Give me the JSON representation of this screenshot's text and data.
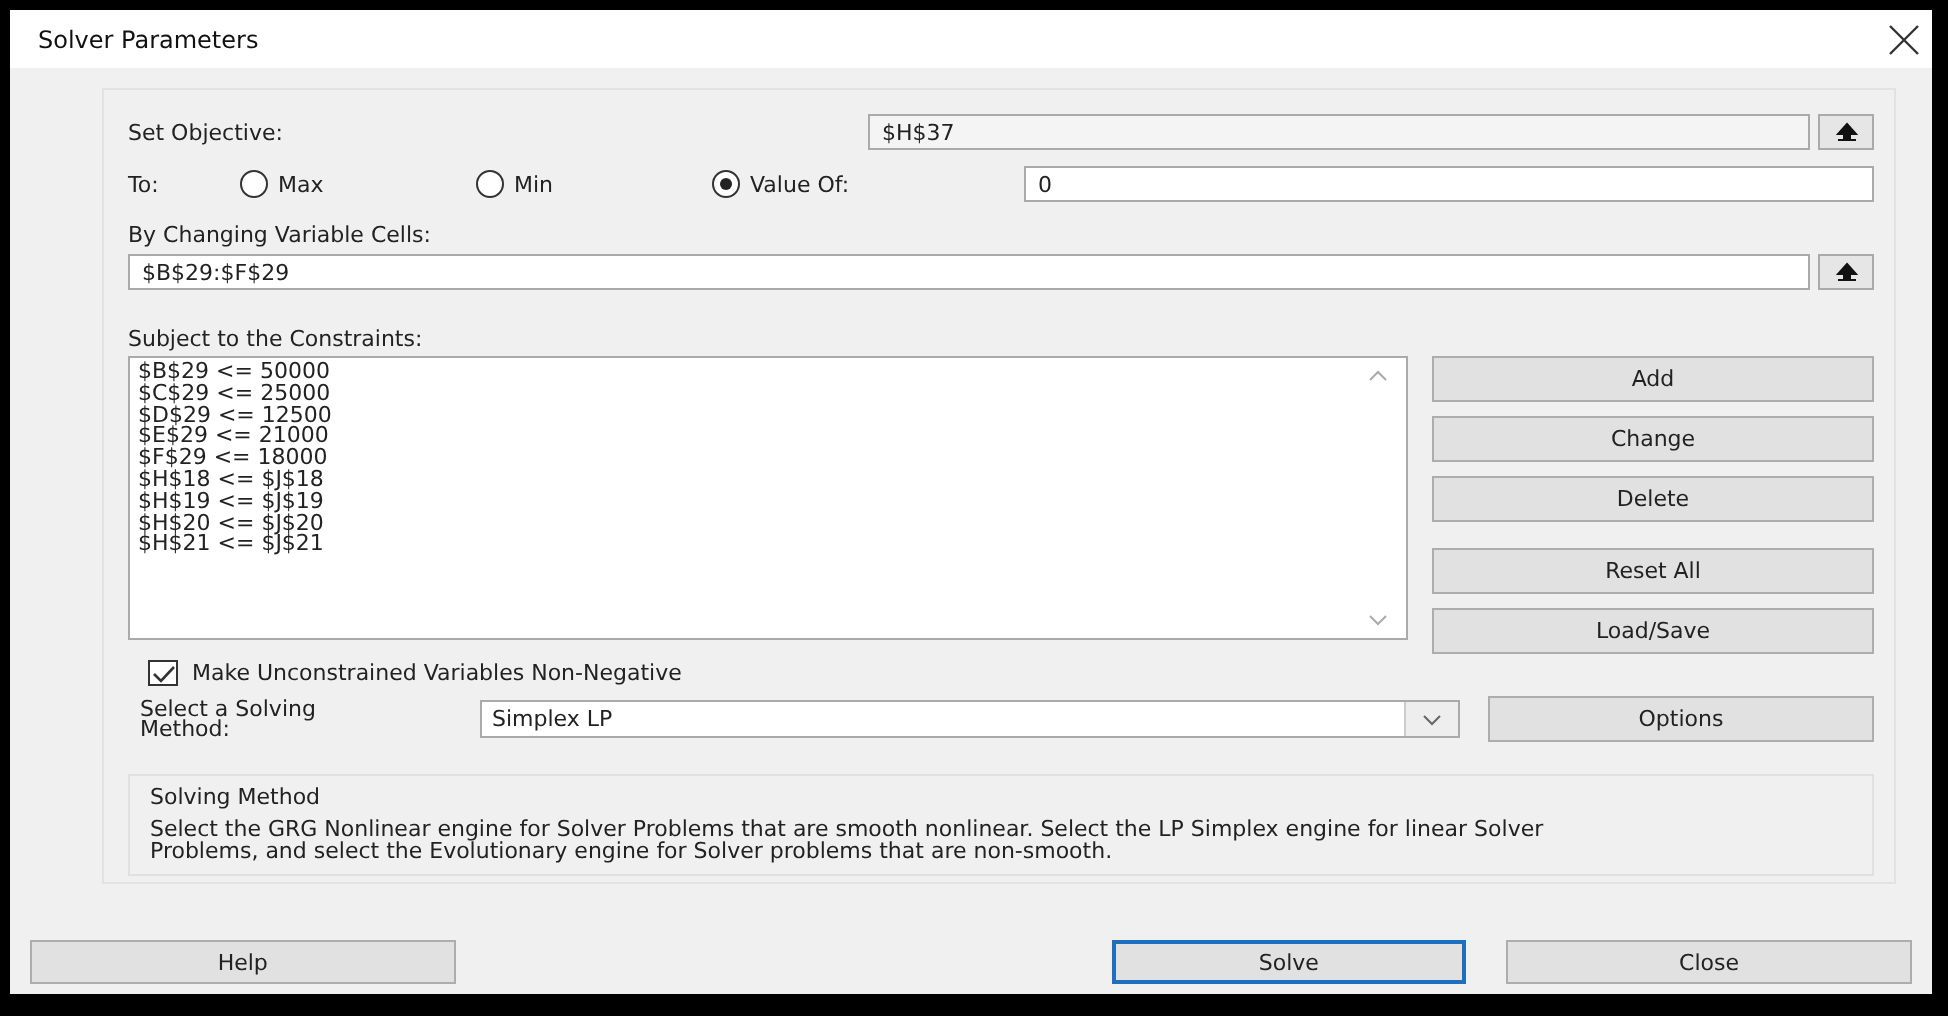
{
  "window": {
    "title": "Solver Parameters"
  },
  "objective": {
    "label": "Set Objective:",
    "value": "$H$37"
  },
  "to": {
    "label": "To:",
    "options": [
      {
        "label": "Max",
        "selected": false
      },
      {
        "label": "Min",
        "selected": false
      },
      {
        "label": "Value Of:",
        "selected": true
      }
    ],
    "value": "0"
  },
  "changing": {
    "label": "By Changing Variable Cells:",
    "value": "$B$29:$F$29"
  },
  "constraints": {
    "label": "Subject to the Constraints:",
    "items": [
      "$B$29 <= 50000",
      "$C$29 <= 25000",
      "$D$29 <= 12500",
      "$E$29 <= 21000",
      "$F$29 <= 18000",
      "$H$18 <= $J$18",
      "$H$19 <= $J$19",
      "$H$20 <= $J$20",
      "$H$21 <= $J$21"
    ]
  },
  "constraint_buttons": [
    "Add",
    "Change",
    "Delete",
    "Reset All",
    "Load/Save"
  ],
  "non_negative": {
    "label": "Make Unconstrained Variables Non-Negative",
    "checked": true
  },
  "method": {
    "label": "Select a Solving Method:",
    "value": "Simplex LP",
    "options_button": "Options"
  },
  "solving_method": {
    "title": "Solving Method",
    "text": "Select the GRG Nonlinear engine for Solver Problems that are smooth nonlinear. Select the LP Simplex engine for linear Solver Problems, and select the Evolutionary engine for Solver problems that are non-smooth."
  },
  "footer_buttons": [
    {
      "label": "Help",
      "default": false
    },
    {
      "label": "Solve",
      "default": true
    },
    {
      "label": "Close",
      "default": false
    }
  ]
}
